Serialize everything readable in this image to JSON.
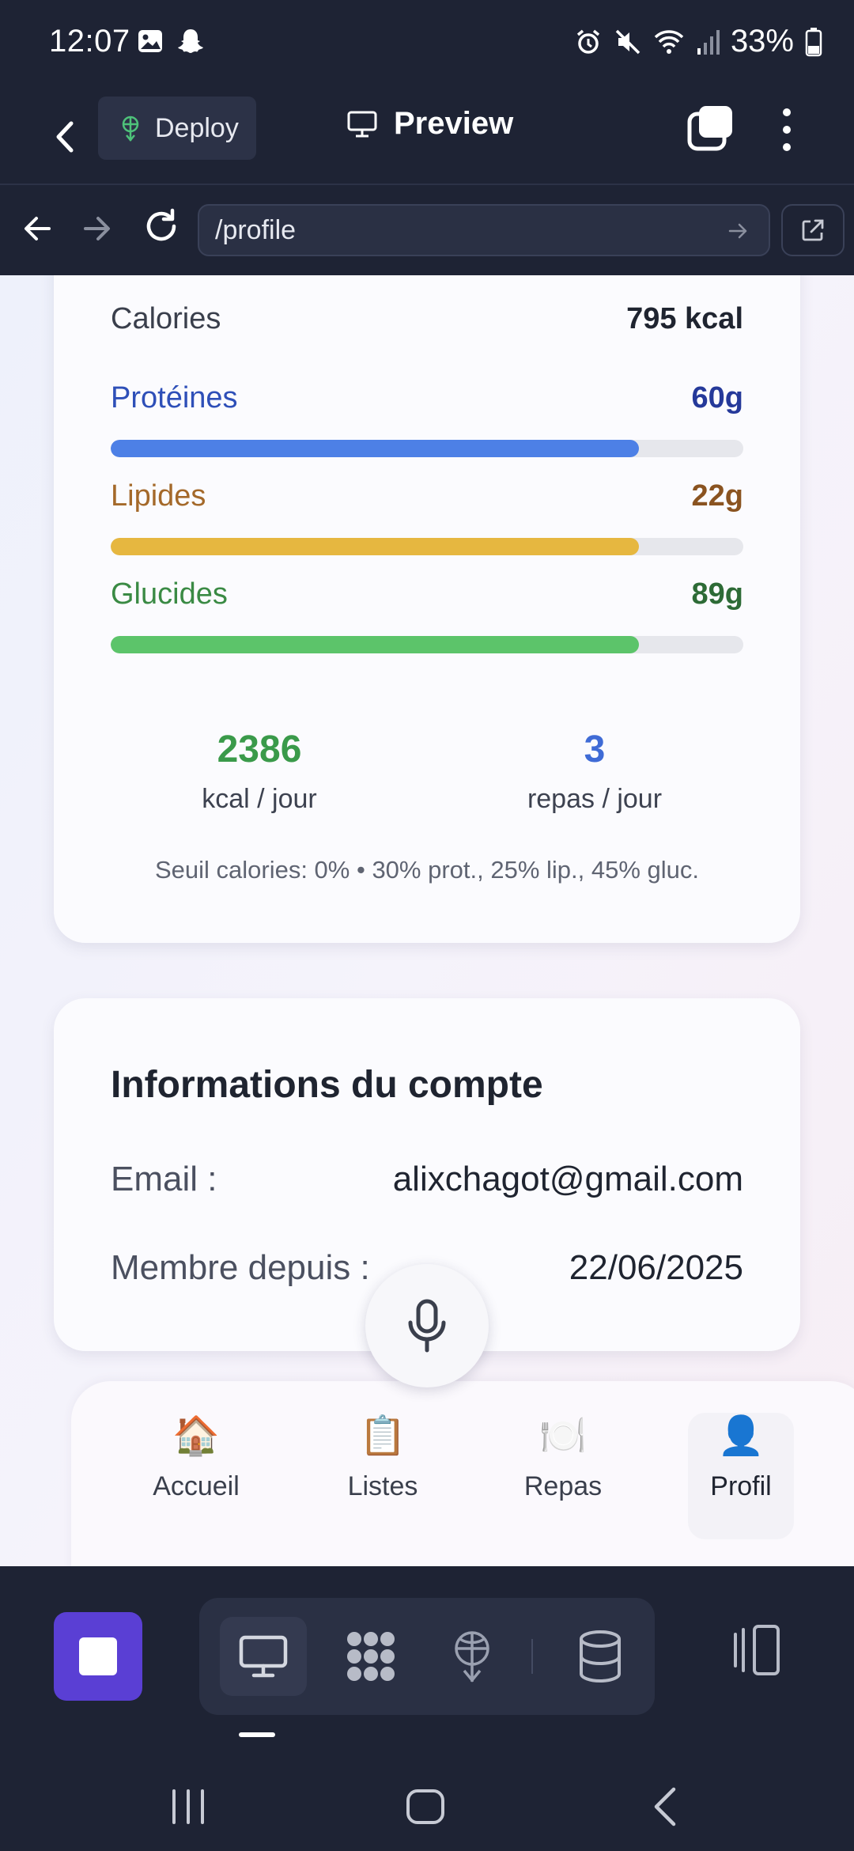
{
  "status_bar": {
    "time": "12:07",
    "battery": "33%"
  },
  "header": {
    "deploy_label": "Deploy",
    "preview_label": "Preview"
  },
  "browser": {
    "url": "/profile"
  },
  "nutrition": {
    "calories_label": "Calories",
    "calories_value": "795 kcal",
    "macros": [
      {
        "label": "Protéines",
        "value": "60g",
        "color": "#4d80e6",
        "text_color": "#2e4fb8",
        "value_color": "#25399a",
        "fill": 0.835
      },
      {
        "label": "Lipides",
        "value": "22g",
        "color": "#e6b740",
        "text_color": "#a4692a",
        "value_color": "#8a5320",
        "fill": 0.835
      },
      {
        "label": "Glucides",
        "value": "89g",
        "color": "#5cc46a",
        "text_color": "#3a8a44",
        "value_color": "#2d6b36",
        "fill": 0.835
      }
    ],
    "daily_kcal": "2386",
    "daily_kcal_unit": "kcal / jour",
    "meals_per_day": "3",
    "meals_unit": "repas / jour",
    "threshold_text": "Seuil calories: 0% • 30% prot., 25% lip., 45% gluc.",
    "accent_green": "#3a9a4a",
    "accent_blue": "#3f6bd6"
  },
  "account": {
    "title": "Informations du compte",
    "email_label": "Email :",
    "email_value": "alixchagot@gmail.com",
    "member_label": "Membre depuis :",
    "member_value": "22/06/2025"
  },
  "bottom_nav": [
    {
      "icon": "house-icon",
      "emoji": "🏠",
      "label": "Accueil"
    },
    {
      "icon": "clipboard-icon",
      "emoji": "📋",
      "label": "Listes"
    },
    {
      "icon": "plate-icon",
      "emoji": "🍽️",
      "label": "Repas"
    },
    {
      "icon": "user-icon",
      "emoji": "👤",
      "label": "Profil",
      "active": true
    }
  ],
  "ide": {
    "stop_color": "#5a3fd4"
  }
}
